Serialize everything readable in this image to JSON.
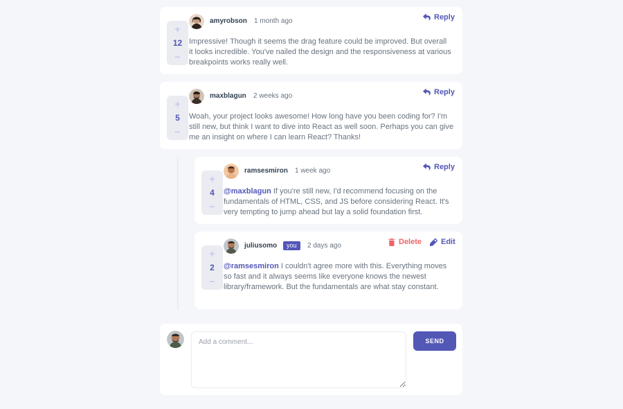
{
  "comments": [
    {
      "username": "amyrobson",
      "time": "1 month ago",
      "score": "12",
      "upvote": "+",
      "downvote": "−",
      "reply_label": "Reply",
      "content": "Impressive! Though it seems the drag feature could be improved. But overall it looks incredible. You've nailed the design and the responsiveness at various breakpoints works really well.",
      "avatar_color": "#3a2a22"
    },
    {
      "username": "maxblagun",
      "time": "2 weeks ago",
      "score": "5",
      "upvote": "+",
      "downvote": "−",
      "reply_label": "Reply",
      "content": "Woah, your project looks awesome! How long have you been coding for? I'm still new, but think I want to dive into React as well soon. Perhaps you can give me an insight on where I can learn React? Thanks!",
      "avatar_color": "#4a3a30"
    }
  ],
  "replies": [
    {
      "username": "ramsesmiron",
      "time": "1 week ago",
      "score": "4",
      "upvote": "+",
      "downvote": "−",
      "reply_label": "Reply",
      "mention": "@maxblagun",
      "content": " If you're still new, I'd recommend focusing on the fundamentals of HTML, CSS, and JS before considering React. It's very tempting to jump ahead but lay a solid foundation first.",
      "avatar_color": "#c98a5a"
    },
    {
      "username": "juliusomo",
      "you_badge": "you",
      "time": "2 days ago",
      "score": "2",
      "upvote": "+",
      "downvote": "−",
      "delete_label": "Delete",
      "edit_label": "Edit",
      "mention": "@ramsesmiron",
      "content": " I couldn't agree more with this. Everything moves so fast and it always seems like everyone knows the newest library/framework. But the fundamentals are what stay constant.",
      "avatar_color": "#6b5548"
    }
  ],
  "composer": {
    "placeholder": "Add a comment...",
    "send_label": "SEND",
    "avatar_color": "#6b5548"
  },
  "colors": {
    "primary": "#5357b6",
    "danger": "#ed6468",
    "background": "#f5f6fa"
  }
}
